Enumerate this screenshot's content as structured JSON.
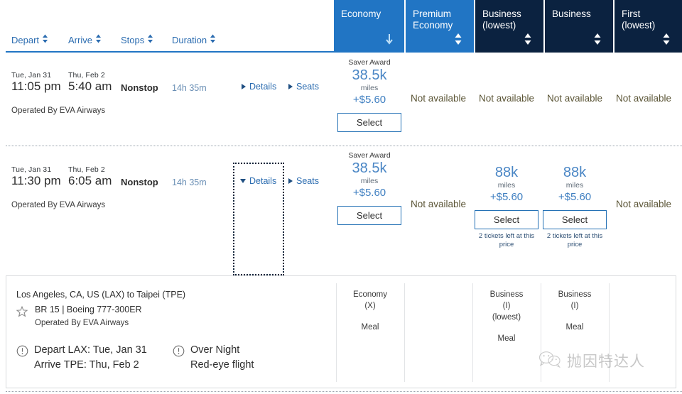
{
  "fare_headers": [
    {
      "label": "Economy",
      "arrow": "down-arrow-icon",
      "state": "selected",
      "bg": "#2175c4"
    },
    {
      "label": "Premium\nEconomy",
      "arrow": "sort-updown-icon",
      "state": "selected",
      "bg": "#2175c4"
    },
    {
      "label": "Business\n(lowest)",
      "arrow": "sort-updown-icon",
      "state": "normal",
      "bg": "#0b2240"
    },
    {
      "label": "Business",
      "arrow": "sort-updown-icon",
      "state": "normal",
      "bg": "#0b2240"
    },
    {
      "label": "First\n(lowest)",
      "arrow": "sort-updown-icon",
      "state": "normal",
      "bg": "#0b2240"
    }
  ],
  "sort_bar": {
    "items": [
      {
        "label": "Depart"
      },
      {
        "label": "Arrive"
      },
      {
        "label": "Stops"
      },
      {
        "label": "Duration"
      }
    ]
  },
  "flights": [
    {
      "depart_date": "Tue, Jan 31",
      "depart_time": "11:05 pm",
      "arrive_date": "Thu, Feb 2",
      "arrive_time": "5:40 am",
      "stops": "Nonstop",
      "duration": "14h 35m",
      "details_label": "Details",
      "seats_label": "Seats",
      "operated_by": "Operated By EVA Airways",
      "expanded": false,
      "fares": [
        {
          "available": true,
          "award_type": "Saver Award",
          "miles": "38.5k",
          "miles_label": "miles",
          "tax": "+$5.60",
          "select_label": "Select",
          "low_stock": ""
        },
        {
          "available": false,
          "unavailable_label": "Not available"
        },
        {
          "available": false,
          "unavailable_label": "Not available"
        },
        {
          "available": false,
          "unavailable_label": "Not available"
        },
        {
          "available": false,
          "unavailable_label": "Not available"
        }
      ]
    },
    {
      "depart_date": "Tue, Jan 31",
      "depart_time": "11:30 pm",
      "arrive_date": "Thu, Feb 2",
      "arrive_time": "6:05 am",
      "stops": "Nonstop",
      "duration": "14h 35m",
      "details_label": "Details",
      "seats_label": "Seats",
      "operated_by": "Operated By EVA Airways",
      "expanded": true,
      "fares": [
        {
          "available": true,
          "award_type": "Saver Award",
          "miles": "38.5k",
          "miles_label": "miles",
          "tax": "+$5.60",
          "select_label": "Select",
          "low_stock": ""
        },
        {
          "available": false,
          "unavailable_label": "Not available"
        },
        {
          "available": true,
          "award_type": "",
          "miles": "88k",
          "miles_label": "miles",
          "tax": "+$5.60",
          "select_label": "Select",
          "low_stock": "2 tickets left at this price"
        },
        {
          "available": true,
          "award_type": "",
          "miles": "88k",
          "miles_label": "miles",
          "tax": "+$5.60",
          "select_label": "Select",
          "low_stock": "2 tickets left at this price"
        },
        {
          "available": false,
          "unavailable_label": "Not available"
        }
      ]
    }
  ],
  "detail_panel": {
    "route": "Los Angeles, CA, US (LAX) to Taipei (TPE)",
    "flight_line": "BR 15 | Boeing 777-300ER",
    "operated_by": "Operated By EVA Airways",
    "notes": [
      {
        "icon": "exclamation-circle-icon",
        "text": "Depart LAX: Tue, Jan 31\nArrive TPE: Thu, Feb 2"
      },
      {
        "icon": "exclamation-circle-icon",
        "text": "Over Night\nRed-eye flight"
      }
    ],
    "cabins": [
      {
        "class": "Economy\n(X)",
        "meal": "Meal"
      },
      {
        "class": "",
        "meal": ""
      },
      {
        "class": "Business\n(I)\n(lowest)",
        "meal": "Meal"
      },
      {
        "class": "Business\n(I)",
        "meal": "Meal"
      },
      {
        "class": "",
        "meal": ""
      }
    ]
  },
  "watermark": {
    "text": "抛因特达人",
    "icon": "wechat-logo-icon"
  }
}
